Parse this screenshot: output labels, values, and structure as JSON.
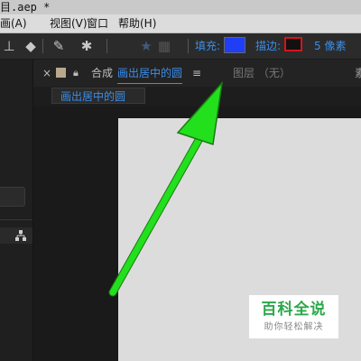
{
  "titlebar": {
    "text": "目.aep *"
  },
  "menubar": {
    "items": [
      "画(A)",
      "视图(V)",
      "窗口",
      "帮助(H)"
    ]
  },
  "toolbar": {
    "fill_label": "填充:",
    "stroke_label": "描边:",
    "stroke_width": "5 像素",
    "fill_color": "#1f3ef5",
    "stroke_color": "#111111",
    "highlight_color": "#d4141a"
  },
  "tabs": {
    "close": "×",
    "comp_prefix": "合成",
    "comp_name": "画出居中的圆",
    "menu": "≡",
    "layer_label": "图层 （无）",
    "cut_label": "素"
  },
  "composition": {
    "breadcrumb": "画出居中的圆",
    "canvas_color": "#dcdcdc"
  },
  "watermark": {
    "title": "百科全说",
    "subtitle": "助你轻松解决"
  },
  "annotation": {
    "color": "#22e01c"
  }
}
